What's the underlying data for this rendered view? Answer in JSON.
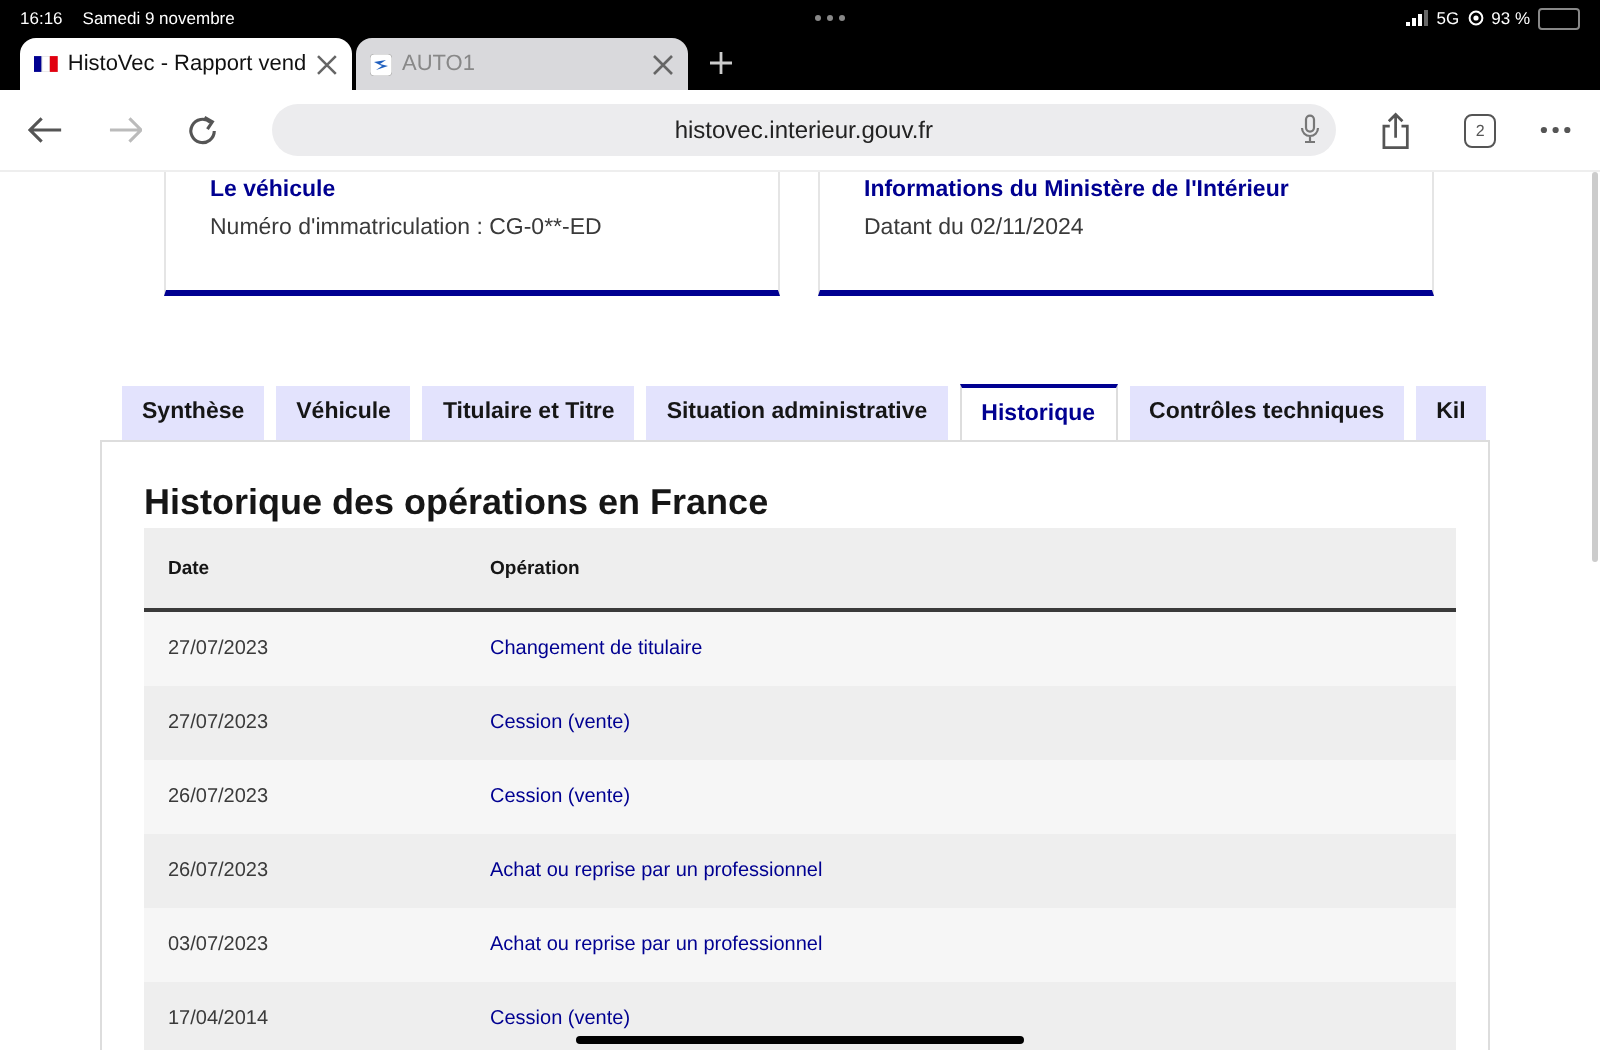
{
  "status_bar": {
    "time": "16:16",
    "date": "Samedi 9 novembre",
    "network": "5G",
    "battery": "93 %"
  },
  "browser_tabs": [
    {
      "title": "HistoVec - Rapport vend",
      "selected": true,
      "kind": "flag"
    },
    {
      "title": "AUTO1",
      "selected": false,
      "kind": "logo"
    }
  ],
  "toolbar": {
    "forward_disabled": true,
    "url": "histovec.interieur.gouv.fr",
    "tab_count": "2"
  },
  "cards": [
    {
      "title": "Le véhicule",
      "text": "Numéro d'immatriculation : CG-0**-ED"
    },
    {
      "title": "Informations du Ministère de l'Intérieur",
      "text": "Datant du 02/11/2024"
    }
  ],
  "tabs": [
    {
      "label": "Synthèse",
      "selected": false
    },
    {
      "label": "Véhicule",
      "selected": false
    },
    {
      "label": "Titulaire et Titre",
      "selected": false
    },
    {
      "label": "Situation administrative",
      "selected": false
    },
    {
      "label": "Historique",
      "selected": true
    },
    {
      "label": "Contrôles techniques",
      "selected": false
    },
    {
      "label": "Kil",
      "selected": false
    }
  ],
  "table": {
    "title": "Historique des opérations en France",
    "columns": [
      "Date",
      "Opération"
    ],
    "rows": [
      [
        "27/07/2023",
        "Changement de titulaire"
      ],
      [
        "27/07/2023",
        "Cession (vente)"
      ],
      [
        "26/07/2023",
        "Cession (vente)"
      ],
      [
        "26/07/2023",
        "Achat ou reprise par un professionnel"
      ],
      [
        "03/07/2023",
        "Achat ou reprise par un professionnel"
      ],
      [
        "17/04/2014",
        "Cession (vente)"
      ]
    ]
  }
}
